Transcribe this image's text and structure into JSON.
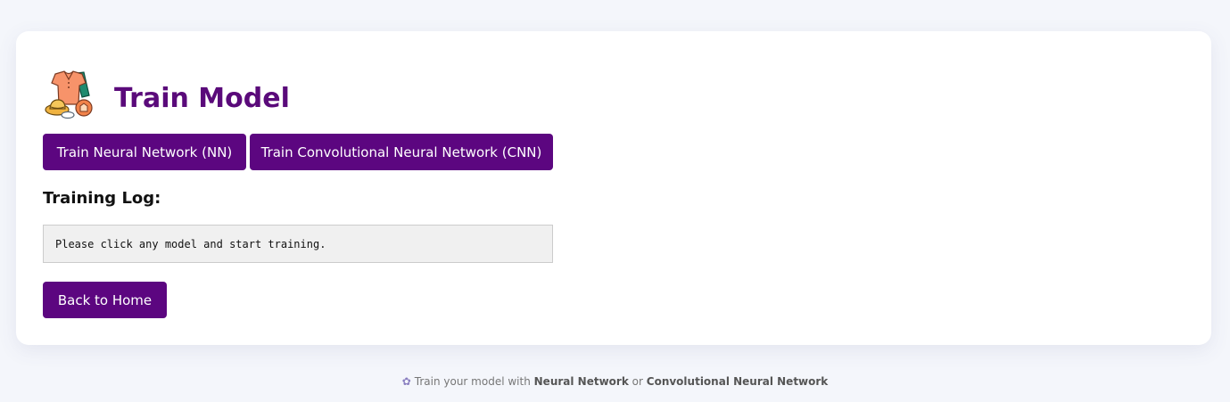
{
  "header": {
    "title": "Train Model",
    "logo_icon": "clothing-icon"
  },
  "actions": {
    "train_nn_label": "Train Neural Network (NN)",
    "train_cnn_label": "Train Convolutional Neural Network (CNN)"
  },
  "log": {
    "heading": "Training Log:",
    "text": "Please click any model and start training."
  },
  "nav": {
    "back_label": "Back to Home"
  },
  "footer": {
    "icon": "gear-icon",
    "prefix": "Train your model with",
    "nn": "Neural Network",
    "or": "or",
    "cnn": "Convolutional Neural Network"
  },
  "colors": {
    "accent": "#5c0680",
    "title": "#5a0a7a",
    "background": "#f4f6fb"
  }
}
